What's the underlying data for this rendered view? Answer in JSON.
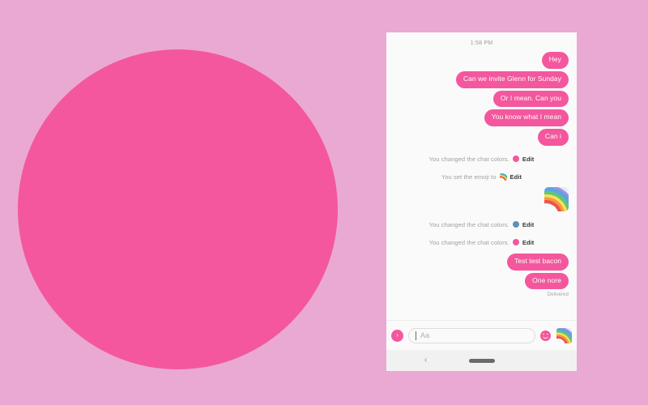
{
  "canvas": {
    "background_color": "#eaa9d2",
    "circle_color": "#f4579d"
  },
  "phone": {
    "panel_background": "#fbfafa",
    "accent_color": "#f4579d",
    "thread": {
      "timestamp": "1:58 PM",
      "messages": [
        {
          "kind": "bubble",
          "side": "outgoing",
          "text": "Hey"
        },
        {
          "kind": "bubble",
          "side": "outgoing",
          "text": "Can we invite Glenn for Sunday"
        },
        {
          "kind": "bubble",
          "side": "outgoing",
          "text": "Or I mean. Can you"
        },
        {
          "kind": "bubble",
          "side": "outgoing",
          "text": "You know what I mean"
        },
        {
          "kind": "bubble",
          "side": "outgoing",
          "text": "Can i"
        }
      ],
      "events": [
        {
          "text": "You changed the chat colors.",
          "swatch": "pink",
          "swatch_color": "#f4579d",
          "action": "Edit"
        },
        {
          "text": "You set the emoji to",
          "swatch": "rainbow",
          "action": "Edit"
        },
        {
          "text": "You changed the chat colors.",
          "swatch": "blue",
          "swatch_color": "#5e90b8",
          "action": "Edit"
        },
        {
          "text": "You changed the chat colors.",
          "swatch": "pink",
          "swatch_color": "#f4579d",
          "action": "Edit"
        }
      ],
      "sticker": {
        "name": "rainbow-sticker"
      },
      "tail_messages": [
        {
          "kind": "bubble",
          "side": "outgoing",
          "text": "Test test bacon"
        },
        {
          "kind": "bubble",
          "side": "outgoing",
          "text": "One nore"
        }
      ],
      "delivery_status": "Delivered"
    },
    "composer": {
      "expand_icon": "›",
      "input_placeholder": "Aa",
      "input_value": "",
      "emoji_icon": "smiley-face-icon",
      "sticker_icon": "rainbow-sticker-icon"
    },
    "navbar": {
      "back_icon": "‹",
      "home_indicator": "home-pill"
    }
  }
}
